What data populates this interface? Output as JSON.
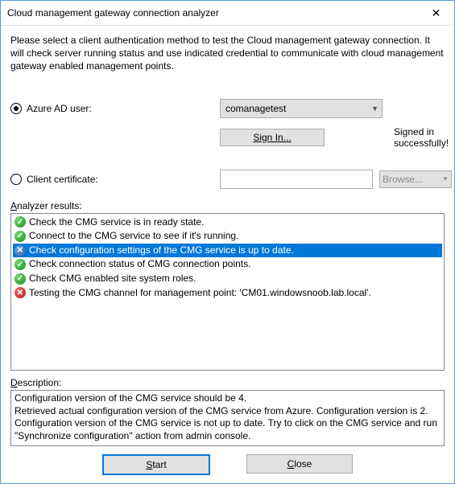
{
  "window": {
    "title": "Cloud management gateway connection analyzer"
  },
  "intro": "Please select a client authentication method to test the Cloud management gateway connection. It will check server running status and use indicated credential to communicate with cloud management gateway enabled management points.",
  "auth": {
    "azure_label": "Azure AD user:",
    "cert_label": "Client certificate:",
    "combo_value": "comanagetest",
    "sign_in_label": "Sign In...",
    "sign_in_status": "Signed in successfully!",
    "browse_label": "Browse..."
  },
  "results_section": {
    "label_first": "A",
    "label_rest": "nalyzer results:"
  },
  "results": [
    {
      "icon": "ok",
      "text": "Check the CMG service is in ready state."
    },
    {
      "icon": "ok",
      "text": "Connect to the CMG service to see if it's running."
    },
    {
      "icon": "info",
      "text": "Check configuration settings of the CMG service is up to date.",
      "selected": true
    },
    {
      "icon": "ok",
      "text": "Check connection status of CMG connection points."
    },
    {
      "icon": "ok",
      "text": "Check CMG enabled site system roles."
    },
    {
      "icon": "err",
      "text": "Testing the CMG channel for management point: 'CM01.windowsnoob.lab.local'."
    }
  ],
  "description_section": {
    "label_first": "D",
    "label_rest": "escription:"
  },
  "description_lines": [
    "Configuration version of the CMG service should be 4.",
    "Retrieved actual configuration version of the CMG service from Azure. Configuration version is 2.",
    "Configuration version of the CMG service is not up to date. Try to click on the CMG service and run \"Synchronize configuration\" action from admin console."
  ],
  "buttons": {
    "start": "Start",
    "start_u": "S",
    "close": "Close",
    "close_u": "C"
  }
}
